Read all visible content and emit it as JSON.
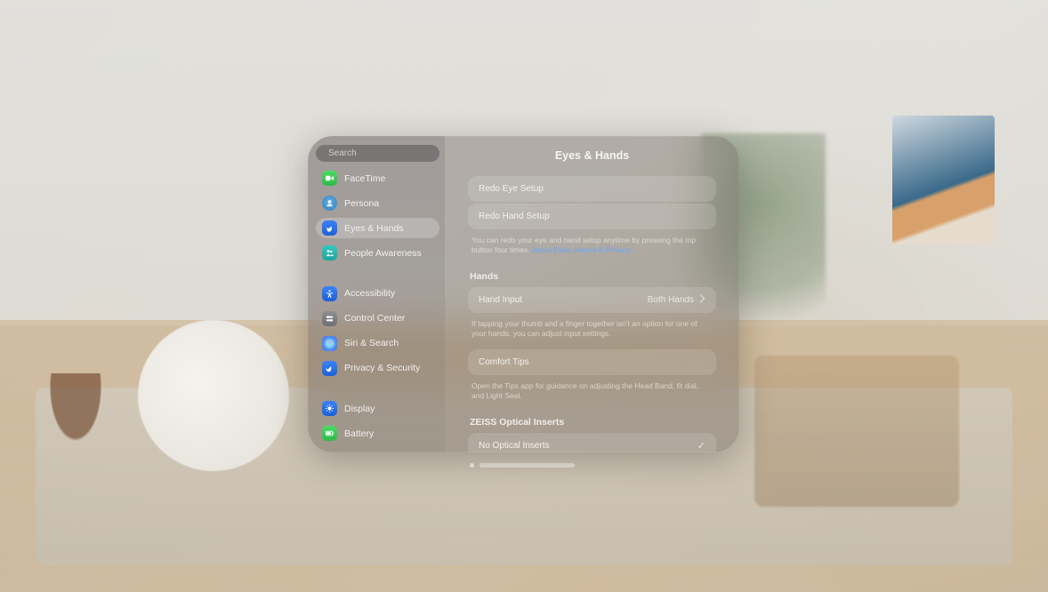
{
  "search": {
    "placeholder": "Search"
  },
  "sidebar": {
    "items": [
      {
        "label": "FaceTime",
        "icon": "video-icon",
        "tint": "ic-green"
      },
      {
        "label": "Persona",
        "icon": "persona-icon",
        "tint": "ic-persona"
      },
      {
        "label": "Eyes & Hands",
        "icon": "hand-icon",
        "tint": "ic-blue",
        "selected": true
      },
      {
        "label": "People Awareness",
        "icon": "people-icon",
        "tint": "ic-teal"
      }
    ],
    "items2": [
      {
        "label": "Accessibility",
        "icon": "accessibility-icon",
        "tint": "ic-blue"
      },
      {
        "label": "Control Center",
        "icon": "switches-icon",
        "tint": "ic-gray"
      },
      {
        "label": "Siri & Search",
        "icon": "siri-icon",
        "tint": "ic-blue"
      },
      {
        "label": "Privacy & Security",
        "icon": "hand-raised-icon",
        "tint": "ic-blue"
      }
    ],
    "items3": [
      {
        "label": "Display",
        "icon": "display-icon",
        "tint": "ic-blue"
      },
      {
        "label": "Battery",
        "icon": "battery-icon",
        "tint": "ic-green"
      }
    ]
  },
  "content": {
    "title": "Eyes & Hands",
    "redo_eye": "Redo Eye Setup",
    "redo_hand": "Redo Hand Setup",
    "redo_caption": "You can redo your eye and hand setup anytime by pressing the top button four times. ",
    "redo_link": "About Eyes, Hands & Privacy…",
    "hands_header": "Hands",
    "hand_input_label": "Hand Input",
    "hand_input_value": "Both Hands",
    "hand_input_caption": "If tapping your thumb and a finger together isn't an option for one of your hands, you can adjust input settings.",
    "comfort_label": "Comfort Tips",
    "comfort_caption": "Open the Tips app for guidance on adjusting the Head Band, fit dial, and Light Seal.",
    "zeiss_header": "ZEISS Optical Inserts",
    "zeiss_option": "No Optical Inserts"
  }
}
